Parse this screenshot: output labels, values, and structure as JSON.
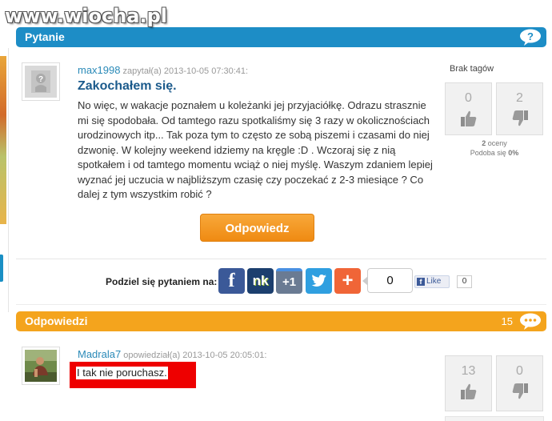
{
  "watermark": "www.wiocha.pl",
  "question_section": {
    "title": "Pytanie"
  },
  "question": {
    "author": "max1998",
    "meta": "zapytał(a) 2013-10-05 07:30:41:",
    "title": "Zakochałem się.",
    "body": "No więc, w wakacje poznałem u koleżanki jej przyjaciółkę. Odrazu strasznie mi się spodobała. Od tamtego razu spotkaliśmy się 3 razy w okolicznościach urodzinowych itp... Tak poza tym to często ze sobą piszemi i czasami do niej dzwonię. W kolejny weekend idziemy na kręgle :D . Wczoraj się z nią spotkałem i od tamtego momentu wciąż o niej myślę. Waszym zdaniem lepiej wyznać jej uczucia w najbliższym czasię czy poczekać z 2-3 miesiące ? Co dalej z tym wszystkim robić ?",
    "tags_label": "Brak tagów",
    "likes": "0",
    "dislikes": "2",
    "ratings_count": "2",
    "ratings_label": "oceny",
    "likes_label": "Podoba się",
    "likes_percent": "0%",
    "answer_button": "Odpowiedz"
  },
  "share": {
    "label": "Podziel się pytaniem na:",
    "count": "0",
    "fb_like": "Like",
    "fb_count": "0",
    "buttons": [
      "f",
      "nk",
      "+1",
      "t",
      "+"
    ]
  },
  "answers_section": {
    "title": "Odpowiedzi",
    "count": "15"
  },
  "answer": {
    "author": "Madrala7",
    "meta": "opowiedział(a) 2013-10-05 20:05:01:",
    "text": "I tak nie poruchasz.",
    "likes": "13",
    "dislikes": "0"
  },
  "colors": {
    "question_bar": "#1d8dc6",
    "answers_bar": "#f4a41d",
    "highlight": "#ee0000",
    "facebook": "#3b5998",
    "nk": "#1c3f6e",
    "gplus": "#6a7b93",
    "twitter": "#2f9fe0",
    "addthis": "#f06537"
  }
}
